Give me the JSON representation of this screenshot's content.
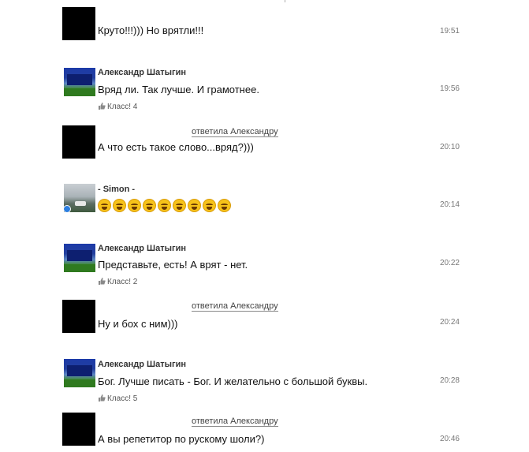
{
  "messages": [
    {
      "id": "m1",
      "author": "",
      "reply_to": "",
      "text": "Круто!!!))) Но врятли!!!",
      "time": "19:51",
      "likes": ""
    },
    {
      "id": "m2",
      "author": "Александр Шатыгин",
      "reply_to": "",
      "text": "Вряд ли.  Так лучше.  И грамотнее.",
      "time": "19:56",
      "likes": "Класс! 4"
    },
    {
      "id": "m3",
      "author": "",
      "reply_to": "ответила Александру",
      "text": "А что есть такое слово...вряд?)))",
      "time": "20:10",
      "likes": ""
    },
    {
      "id": "m4",
      "author": "- Simon -",
      "reply_to": "",
      "text": "",
      "emoji_name": "face-with-tears-of-joy",
      "emoji_count": 9,
      "time": "20:14",
      "likes": ""
    },
    {
      "id": "m5",
      "author": "Александр Шатыгин",
      "reply_to": "",
      "text": "Представьте, есть!  А врят - нет.",
      "time": "20:22",
      "likes": "Класс! 2"
    },
    {
      "id": "m6",
      "author": "",
      "reply_to": "ответила Александру",
      "text": "Ну и бох с ним)))",
      "time": "20:24",
      "likes": ""
    },
    {
      "id": "m7",
      "author": "Александр Шатыгин",
      "reply_to": "",
      "text": "Бог.  Лучше писать - Бог.  И желательно с большой буквы.",
      "time": "20:28",
      "likes": "Класс! 5"
    },
    {
      "id": "m8",
      "author": "",
      "reply_to": "ответила Александру",
      "text": "А вы репетитор по рускому шоли?)",
      "time": "20:46",
      "likes": ""
    }
  ],
  "colors": {
    "online_dot": "#2d7fe0",
    "emoji": "#f6c21a"
  }
}
